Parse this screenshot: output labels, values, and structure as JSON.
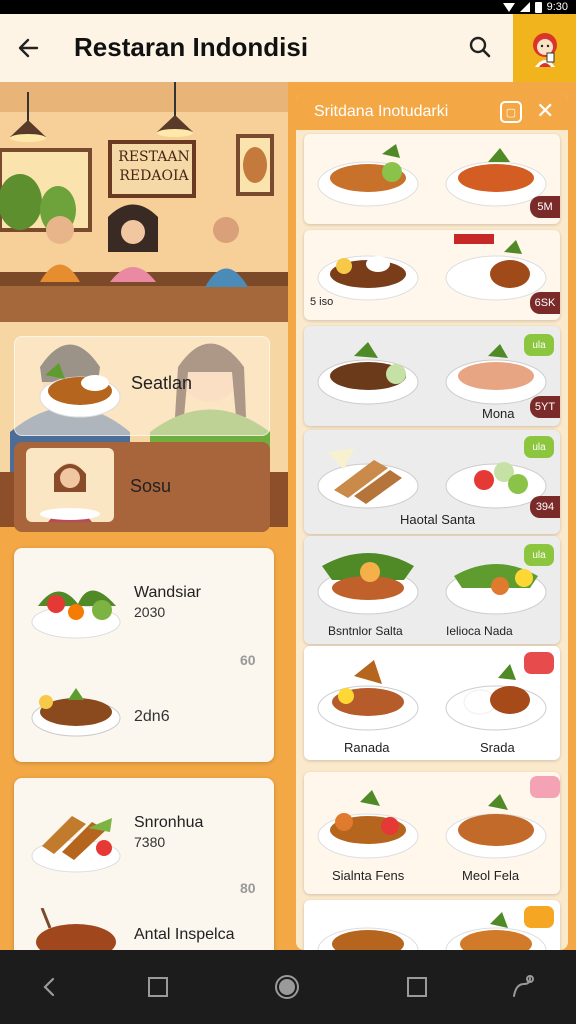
{
  "status": {
    "time": "9:30"
  },
  "header": {
    "title": "Restaran Indondisi"
  },
  "scene": {
    "sign_text": [
      "RESTAAN",
      "REDAOIA"
    ]
  },
  "left": {
    "overlay_cards": [
      {
        "label": "Seatlan"
      },
      {
        "label": "Sosu"
      }
    ],
    "menu_cards": [
      {
        "items": [
          {
            "title": "Wandsiar",
            "sub": "2030"
          },
          {
            "title": "",
            "sub": "2dn6"
          }
        ],
        "right_text": "60"
      },
      {
        "items": [
          {
            "title": "Snronhua",
            "sub": "7380"
          },
          {
            "title": "Antal Inspelca",
            "sub": ""
          }
        ],
        "right_text": "80"
      }
    ]
  },
  "panel": {
    "title": "Sritdana Inotudarki",
    "cards": [
      {
        "labels": [
          "",
          ""
        ],
        "tag": "5M"
      },
      {
        "labels": [
          "5 iso",
          ""
        ],
        "tag": "6SK"
      },
      {
        "labels": [
          "",
          "Mona"
        ],
        "tag": "5YT",
        "badge": "ula"
      },
      {
        "labels": [
          "Haotal Santa",
          ""
        ],
        "tag": "394",
        "badge": "ula"
      },
      {
        "labels": [
          "Bsntnlor Salta",
          "Ielioca Nada"
        ],
        "badge": "ula"
      },
      {
        "labels": [
          "Ranada",
          "Srada"
        ],
        "badge": ""
      },
      {
        "labels": [
          "Sialnta Fens",
          "Meol Fela"
        ],
        "badge": ""
      },
      {
        "labels": [
          "",
          ""
        ],
        "badge": ""
      }
    ]
  },
  "colors": {
    "accent_orange": "#f3a845",
    "accent_yellow": "#f2b41c",
    "price_tag": "#7b2a2a",
    "badge_green": "#8cc63f",
    "badge_red": "#e84b4b",
    "badge_pink": "#f4a3b4",
    "badge_orange": "#f5a623"
  },
  "icons": [
    "back-arrow-icon",
    "search-icon",
    "avatar-icon",
    "receipt-icon",
    "close-icon",
    "nav-back-icon",
    "nav-home-icon",
    "nav-recents-icon"
  ]
}
